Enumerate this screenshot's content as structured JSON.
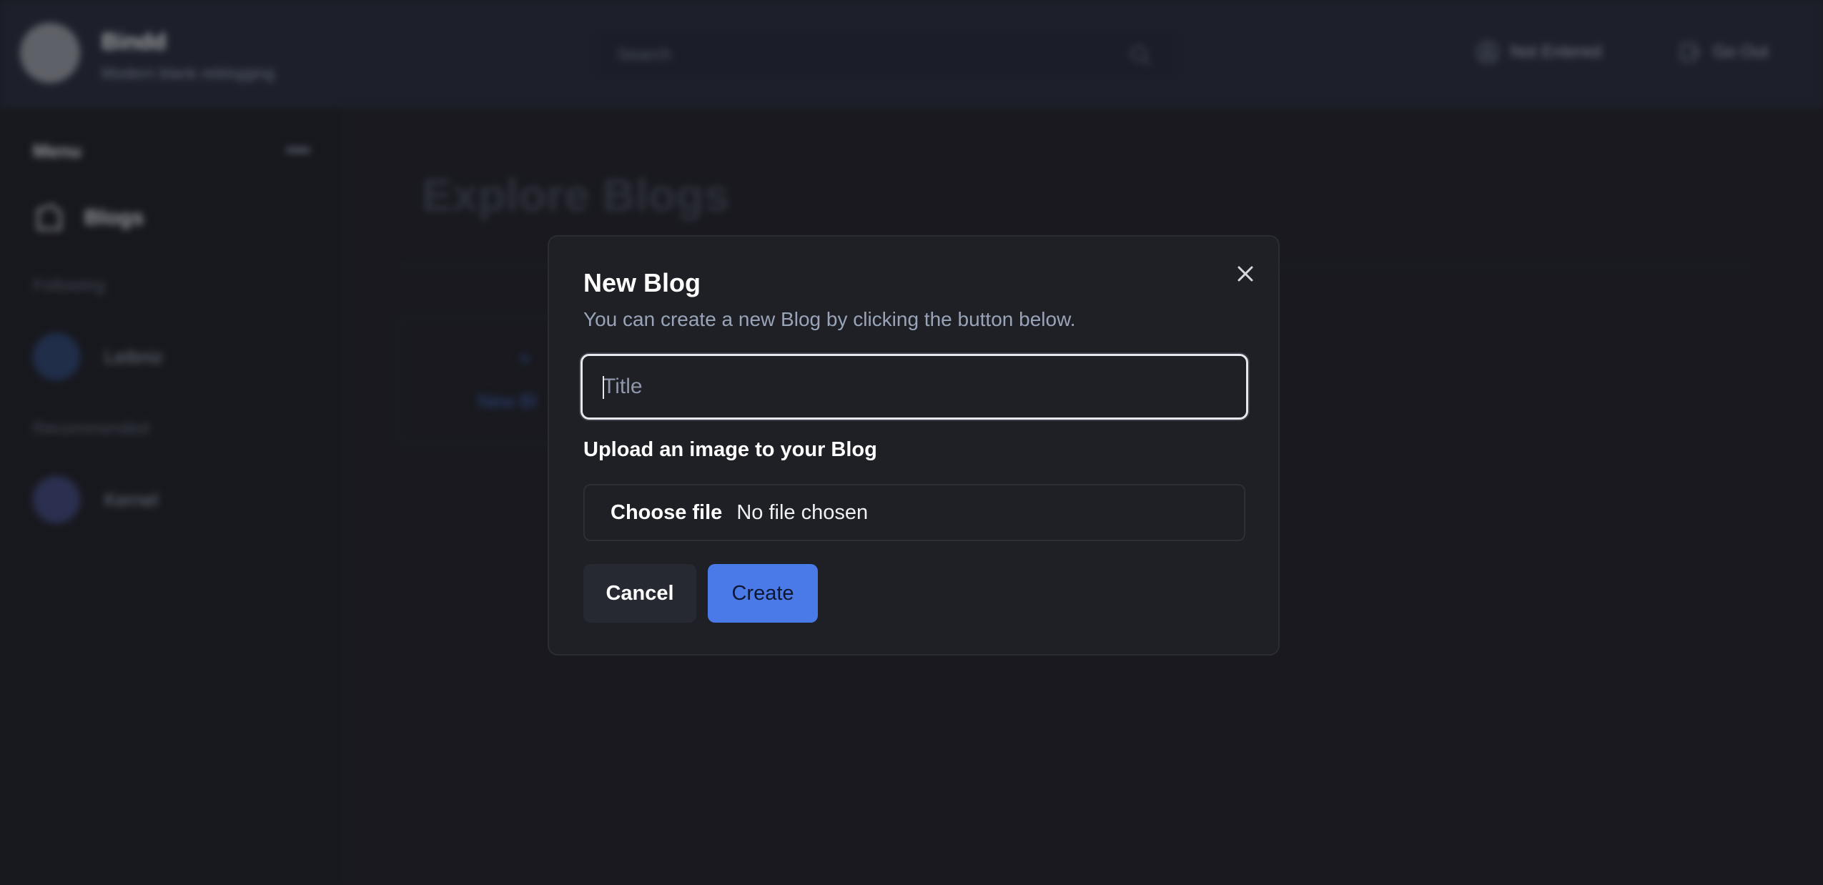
{
  "header": {
    "brand_name": "Bindd",
    "brand_tagline": "Modern blank reblogging",
    "search_placeholder": "Search",
    "actions": [
      {
        "label": "Not Entered",
        "icon": "user-icon"
      },
      {
        "label": "Go Out",
        "icon": "logout-icon"
      }
    ]
  },
  "sidebar": {
    "title": "Menu",
    "items": [
      {
        "label": "Blogs",
        "icon": "blog-icon"
      }
    ],
    "following_label": "Following",
    "following": [
      {
        "name": "Leibniz"
      }
    ],
    "recommended_label": "Recommended",
    "recommended": [
      {
        "name": "Kernel"
      }
    ]
  },
  "main": {
    "title": "Explore Blogs",
    "new_card_label": "New Bl"
  },
  "modal": {
    "title": "New Blog",
    "description": "You can create a new Blog by clicking the button below.",
    "title_input": {
      "placeholder": "Title",
      "value": ""
    },
    "upload_label": "Upload an image to your Blog",
    "file": {
      "button_label": "Choose file",
      "status": "No file chosen"
    },
    "cancel_label": "Cancel",
    "create_label": "Create"
  },
  "colors": {
    "accent": "#4a7ae8",
    "modal_bg": "#1f2026",
    "page_bg": "#1f2026"
  }
}
